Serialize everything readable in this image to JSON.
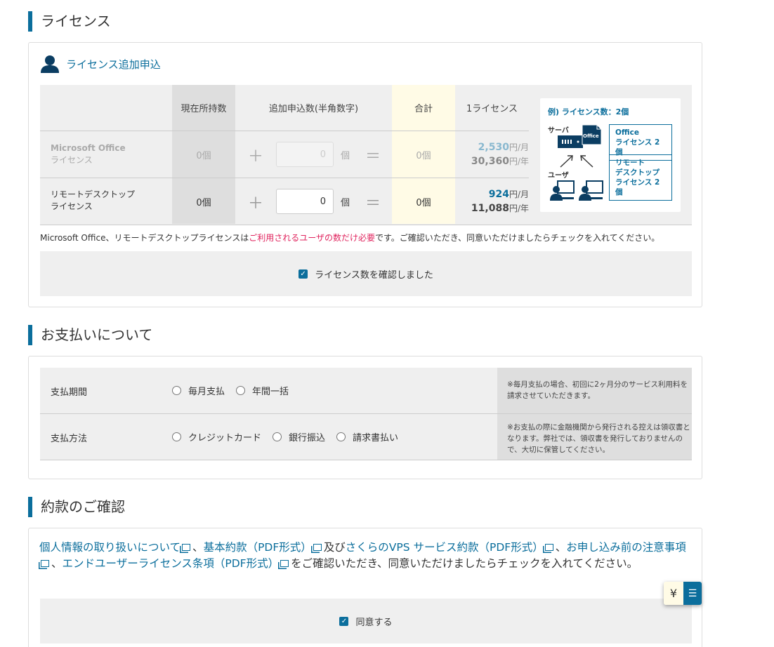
{
  "license": {
    "heading": "ライセンス",
    "subtitle": "ライセンス追加申込",
    "columns": [
      "現在所持数",
      "追加申込数(半角数字)",
      "合計",
      "1ライセンス"
    ],
    "rows": [
      {
        "name1": "Microsoft Office",
        "name2": "ライセンス",
        "current": "0個",
        "qty": "0",
        "unit": "個",
        "total": "0個",
        "price_month": "2,530",
        "month_unit": "円/月",
        "price_year": "30,360",
        "year_unit": "円/年",
        "disabled": true
      },
      {
        "name1": "リモートデスクトップ",
        "name2": "ライセンス",
        "current": "0個",
        "qty": "0",
        "unit": "個",
        "total": "0個",
        "price_month": "924",
        "month_unit": "円/月",
        "price_year": "11,088",
        "year_unit": "円/年",
        "disabled": false
      }
    ],
    "example": {
      "title": "例) ライセンス数：2個",
      "server_label": "サーバ",
      "user_label": "ユーザ",
      "office_chip": "Office",
      "box1_line1": "Office",
      "box1_line2": "ライセンス 2個",
      "box2_line1": "リモート",
      "box2_line2": "デスクトップ",
      "box2_line3": "ライセンス 2個"
    },
    "note_prefix": "Microsoft Office、リモートデスクトップライセンスは",
    "note_highlight": "ご利用されるユーザの数だけ必要",
    "note_suffix": "です。ご確認いただき、同意いただけましたらチェックを入れてください。",
    "confirm_label": "ライセンス数を確認しました",
    "plus": "＋",
    "equals": "＝"
  },
  "payment": {
    "heading": "お支払いについて",
    "period_label": "支払期間",
    "period_options": [
      "毎月支払",
      "年間一括"
    ],
    "period_note": "※毎月支払の場合、初回に2ヶ月分のサービス利用料を請求させていただきます。",
    "method_label": "支払方法",
    "method_options": [
      "クレジットカード",
      "銀行振込",
      "請求書払い"
    ],
    "method_note": "※お支払の際に金融機関から発行される控えは領収書となります。弊社では、領収書を発行しておりませんので、大切に保管してください。"
  },
  "terms": {
    "heading": "約款のご確認",
    "link1": "個人情報の取り扱いについて",
    "sep1": "、",
    "link2": "基本約款（PDF形式）",
    "sep2": "及び",
    "link3": "さくらのVPS サービス約款（PDF形式）",
    "sep3": "、",
    "link4": "お申し込み前の注意事項",
    "sep4": "、",
    "link5": "エンドユーザーライセンス条項（PDF形式）",
    "suffix": "をご確認いただき、同意いただけましたらチェックを入れてください。",
    "agree_label": "同意する"
  },
  "widget": {
    "yen": "¥",
    "list": "☰"
  }
}
